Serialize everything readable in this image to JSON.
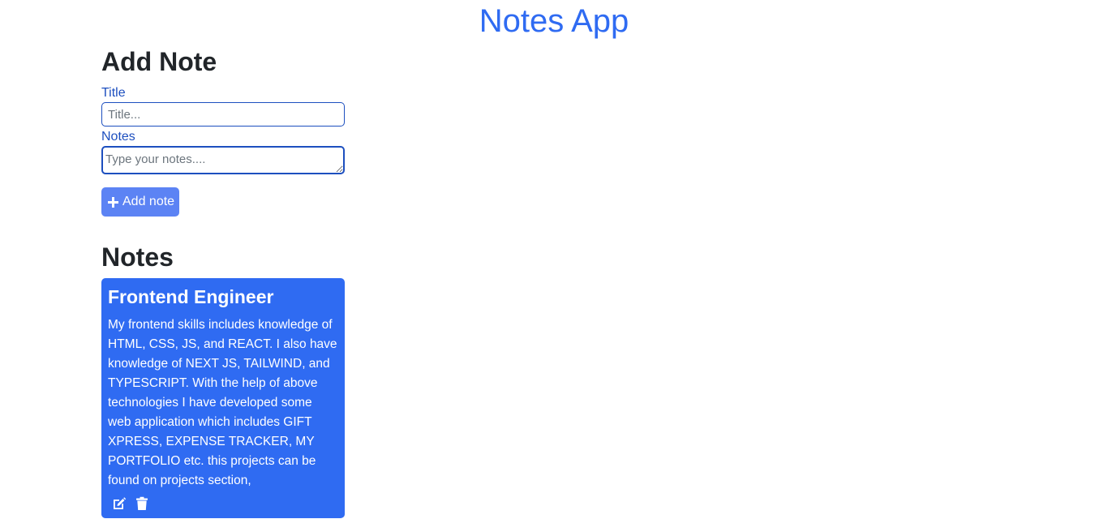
{
  "app": {
    "title": "Notes App",
    "accent_color": "#2f6bf2"
  },
  "add_note": {
    "heading": "Add Note",
    "title_label": "Title",
    "title_placeholder": "Title...",
    "title_value": "",
    "notes_label": "Notes",
    "notes_placeholder": "Type your notes....",
    "notes_value": "",
    "button_icon": "plus-icon",
    "button_label": "Add note"
  },
  "notes_section": {
    "heading": "Notes",
    "notes": [
      {
        "title": "Frontend Engineer",
        "body": "My frontend skills includes knowledge of HTML, CSS, JS, and REACT. I also have knowledge of NEXT JS, TAILWIND, and TYPESCRIPT. With the help of above technologies I have developed some web application which includes GIFT XPRESS, EXPENSE TRACKER, MY PORTFOLIO etc. this projects can be found on projects section,",
        "actions": [
          "edit-icon",
          "trash-icon"
        ]
      }
    ]
  }
}
